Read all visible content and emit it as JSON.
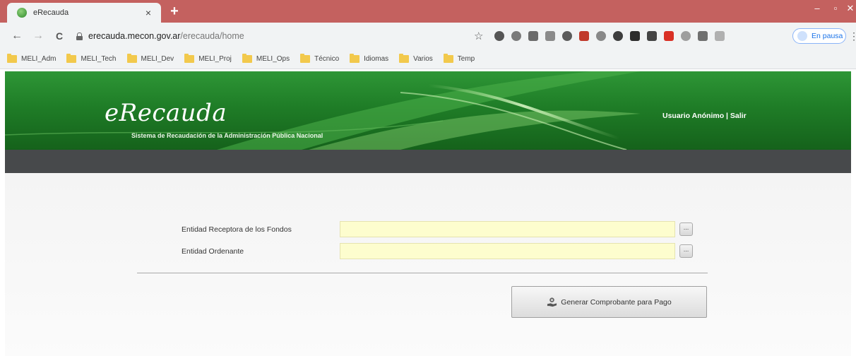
{
  "browser": {
    "tab_title": "eRecauda",
    "tab_close": "×",
    "new_tab": "+",
    "window_minimize": "–",
    "window_maximize": "▫",
    "window_close": "✕",
    "nav_back": "←",
    "nav_forward": "→",
    "nav_reload": "C",
    "url_host": "erecauda.mecon.gov.ar",
    "url_path": "/erecauda/home",
    "bookmark_star": "☆",
    "pause_label": "En pausa",
    "menu": "⋮",
    "bookmarks": [
      {
        "label": "MELI_Adm"
      },
      {
        "label": "MELI_Tech"
      },
      {
        "label": "MELI_Dev"
      },
      {
        "label": "MELI_Proj"
      },
      {
        "label": "MELI_Ops"
      },
      {
        "label": "Técnico"
      },
      {
        "label": "Idiomas"
      },
      {
        "label": "Varios"
      },
      {
        "label": "Temp"
      }
    ]
  },
  "header": {
    "logo": "eRecauda",
    "subtitle": "Sistema de Recaudación de la Administración Pública Nacional",
    "user": "Usuario Anónimo",
    "separator": "|",
    "logout": "Salir"
  },
  "form": {
    "fields": [
      {
        "label": "Entidad Receptora de los Fondos",
        "value": "",
        "lookup": "..."
      },
      {
        "label": "Entidad Ordenante",
        "value": "",
        "lookup": "..."
      }
    ],
    "submit_label": "Generar Comprobante para Pago"
  },
  "colors": {
    "tabstrip": "#c4615f",
    "banner_green": "#1f7d27",
    "darkbar": "#47494b",
    "input_bg": "#fdfdce"
  },
  "icons": {
    "favicon": "green-globe-icon",
    "lock": "lock-icon",
    "folder": "folder-icon",
    "lookup": "ellipsis-icon",
    "submit": "hand-coin-icon"
  }
}
